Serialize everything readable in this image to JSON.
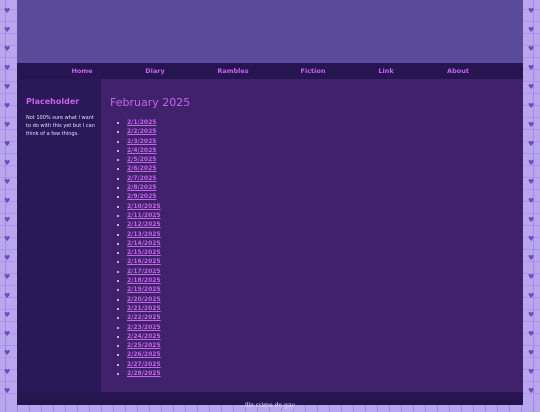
{
  "nav": [
    "Home",
    "Diary",
    "Rambles",
    "Fiction",
    "Link",
    "About"
  ],
  "sidebar": {
    "title": "Placeholder",
    "text": "Not 100% sure what I want to do with this yet but I can think of a few things."
  },
  "main": {
    "title": "February 2025",
    "entries": [
      "2/1/2025",
      "2/2/2025",
      "2/3/2025",
      "2/4/2025",
      "2/5/2025",
      "2/6/2025",
      "2/7/2025",
      "2/8/2025",
      "2/9/2025",
      "2/10/2025",
      "2/11/2025",
      "2/12/2025",
      "2/13/2025",
      "2/14/2025",
      "2/15/2025",
      "2/16/2025",
      "2/17/2025",
      "2/18/2025",
      "2/19/2025",
      "2/20/2025",
      "2/21/2025",
      "2/22/2025",
      "2/23/2025",
      "2/24/2025",
      "2/25/2025",
      "2/26/2025",
      "2/27/2025",
      "2/28/2025"
    ]
  },
  "footer": {
    "text": "Ille crime do gay"
  },
  "colors": {
    "accent": "#c565e9",
    "panel": "#40226c",
    "sidebar": "#2a1858",
    "header": "#5a4b9a",
    "nav": "#261551",
    "text": "#e7e0f7"
  },
  "decor": {
    "heart_icon": "heart-icon"
  }
}
